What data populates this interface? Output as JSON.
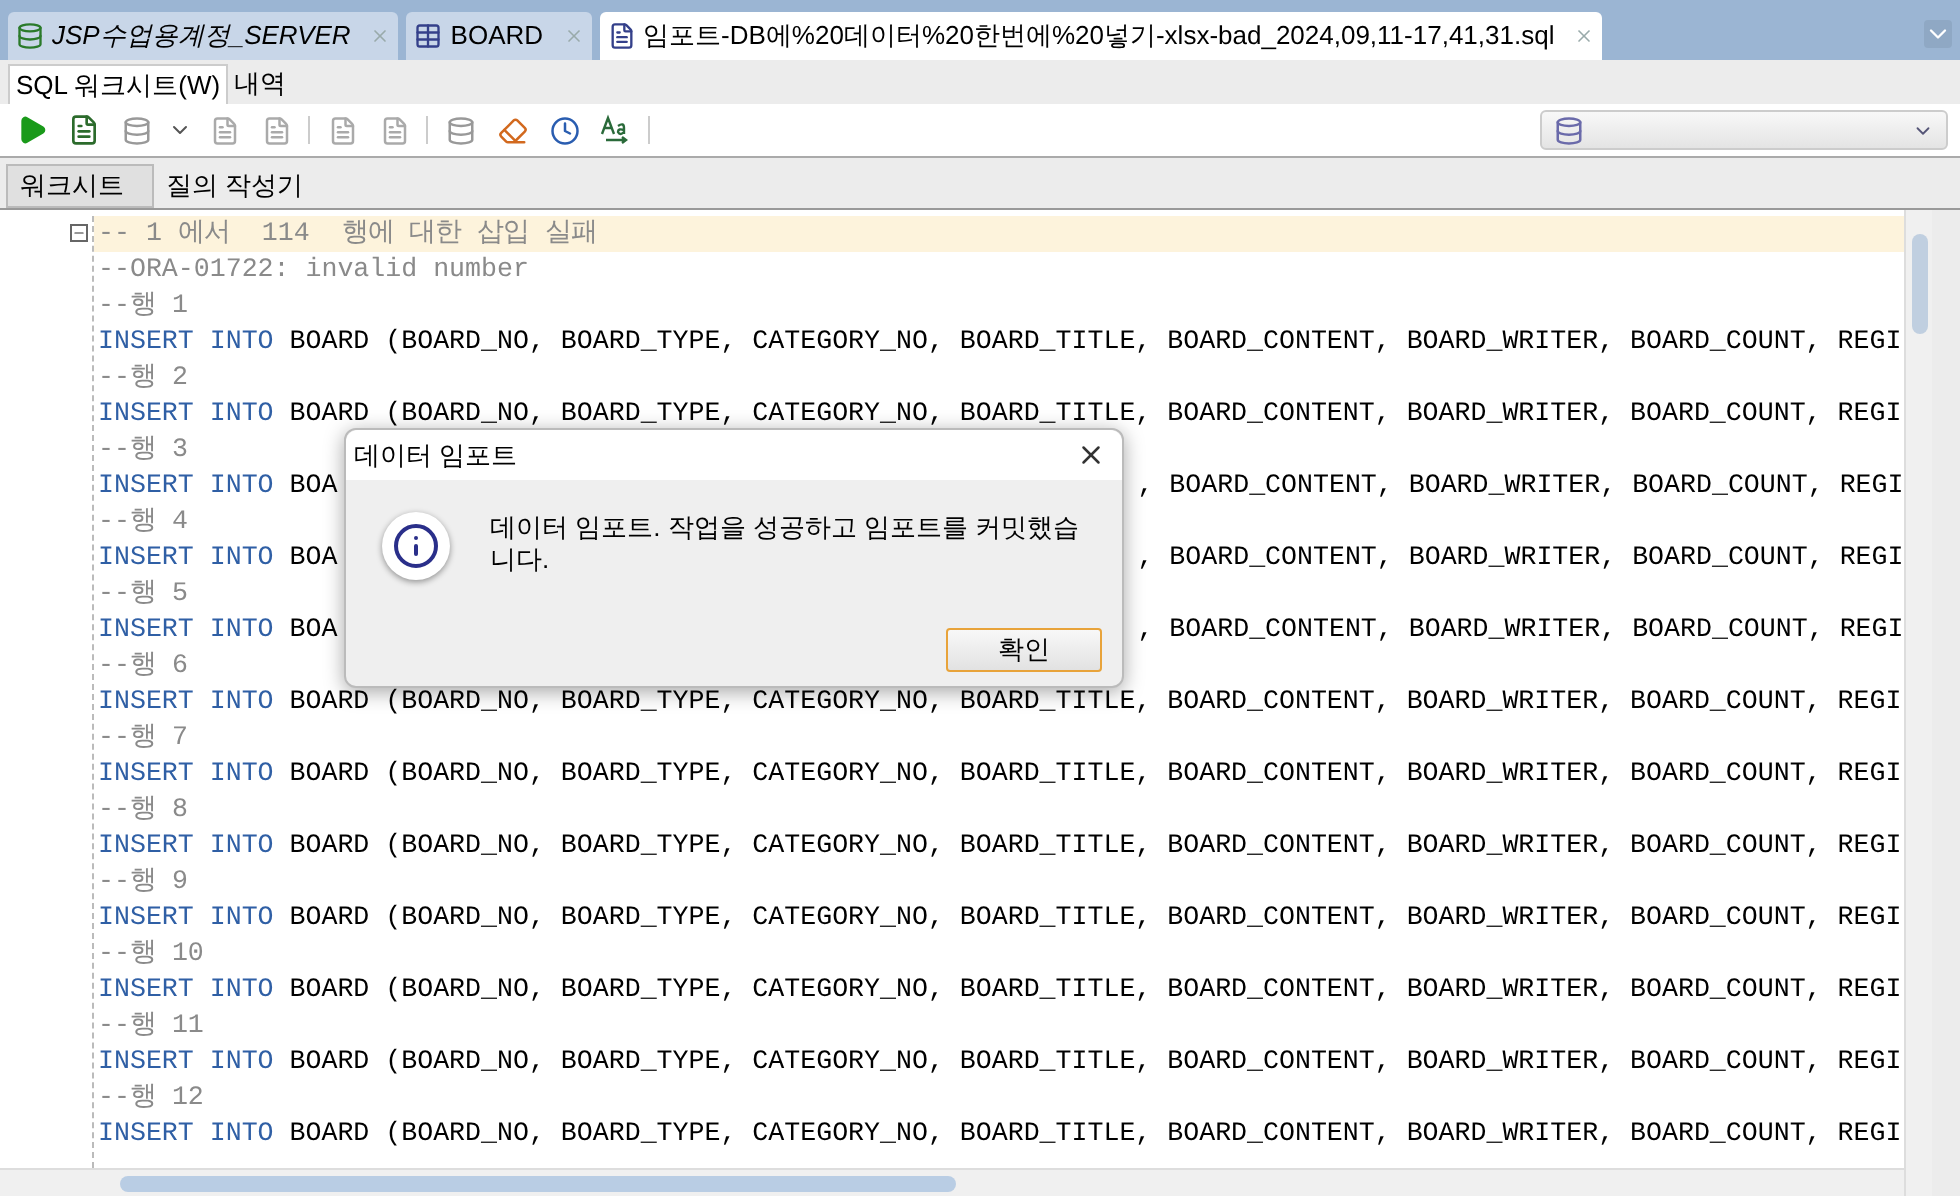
{
  "tabs": [
    {
      "label": "JSP수업용계정_SERVER",
      "kind": "connection",
      "selected": false
    },
    {
      "label": "BOARD",
      "kind": "table",
      "selected": false
    },
    {
      "label": "임포트-DB에%20데이터%20한번에%20넣기-xlsx-bad_2024,09,11-17,41,31.sql",
      "kind": "file",
      "selected": true
    }
  ],
  "menu_tabs": [
    {
      "label": "SQL 워크시트(W)",
      "selected": true
    },
    {
      "label": "내역",
      "selected": false
    }
  ],
  "sub_tabs": [
    {
      "label": "워크시트",
      "selected": true
    },
    {
      "label": "질의 작성기",
      "selected": false
    }
  ],
  "editor": {
    "lines": [
      {
        "kind": "header",
        "text": "-- 1 에서  114  행에 대한 삽입 실패",
        "current": true
      },
      {
        "kind": "comment",
        "text": "--ORA-01722: invalid number",
        "current": false
      },
      {
        "kind": "comment",
        "text": "--행 1",
        "current": false
      },
      {
        "kind": "insert",
        "keyword": "INSERT INTO",
        "text": "BOARD (BOARD_NO, BOARD_TYPE, CATEGORY_NO, BOARD_TITLE, BOARD_CONTENT, BOARD_WRITER, BOARD_COUNT, REGI",
        "current": false
      },
      {
        "kind": "comment",
        "text": "--행 2",
        "current": false
      },
      {
        "kind": "insert",
        "keyword": "INSERT INTO",
        "text": "BOARD (BOARD_NO, BOARD_TYPE, CATEGORY_NO, BOARD_TITLE, BOARD_CONTENT, BOARD_WRITER, BOARD_COUNT, REGI",
        "current": false
      },
      {
        "kind": "comment",
        "text": "--행 3",
        "current": false
      },
      {
        "kind": "insert",
        "keyword": "INSERT INTO",
        "text": "BOA",
        "text_after": ", BOARD_CONTENT, BOARD_WRITER, BOARD_COUNT, REGI",
        "current": false
      },
      {
        "kind": "comment",
        "text": "--행 4",
        "current": false
      },
      {
        "kind": "insert",
        "keyword": "INSERT INTO",
        "text": "BOA",
        "text_after": ", BOARD_CONTENT, BOARD_WRITER, BOARD_COUNT, REGI",
        "current": false
      },
      {
        "kind": "comment",
        "text": "--행 5",
        "current": false
      },
      {
        "kind": "insert",
        "keyword": "INSERT INTO",
        "text": "BOA",
        "text_after": ", BOARD_CONTENT, BOARD_WRITER, BOARD_COUNT, REGI",
        "current": false
      },
      {
        "kind": "comment",
        "text": "--행 6",
        "current": false
      },
      {
        "kind": "insert",
        "keyword": "INSERT INTO",
        "text": "BOARD (BOARD_NO, BOARD_TYPE, CATEGORY_NO, BOARD_TITLE, BOARD_CONTENT, BOARD_WRITER, BOARD_COUNT, REGI",
        "current": false
      },
      {
        "kind": "comment",
        "text": "--행 7",
        "current": false
      },
      {
        "kind": "insert",
        "keyword": "INSERT INTO",
        "text": "BOARD (BOARD_NO, BOARD_TYPE, CATEGORY_NO, BOARD_TITLE, BOARD_CONTENT, BOARD_WRITER, BOARD_COUNT, REGI",
        "current": false
      },
      {
        "kind": "comment",
        "text": "--행 8",
        "current": false
      },
      {
        "kind": "insert",
        "keyword": "INSERT INTO",
        "text": "BOARD (BOARD_NO, BOARD_TYPE, CATEGORY_NO, BOARD_TITLE, BOARD_CONTENT, BOARD_WRITER, BOARD_COUNT, REGI",
        "current": false
      },
      {
        "kind": "comment",
        "text": "--행 9",
        "current": false
      },
      {
        "kind": "insert",
        "keyword": "INSERT INTO",
        "text": "BOARD (BOARD_NO, BOARD_TYPE, CATEGORY_NO, BOARD_TITLE, BOARD_CONTENT, BOARD_WRITER, BOARD_COUNT, REGI",
        "current": false
      },
      {
        "kind": "comment",
        "text": "--행 10",
        "current": false
      },
      {
        "kind": "insert",
        "keyword": "INSERT INTO",
        "text": "BOARD (BOARD_NO, BOARD_TYPE, CATEGORY_NO, BOARD_TITLE, BOARD_CONTENT, BOARD_WRITER, BOARD_COUNT, REGI",
        "current": false
      },
      {
        "kind": "comment",
        "text": "--행 11",
        "current": false
      },
      {
        "kind": "insert",
        "keyword": "INSERT INTO",
        "text": "BOARD (BOARD_NO, BOARD_TYPE, CATEGORY_NO, BOARD_TITLE, BOARD_CONTENT, BOARD_WRITER, BOARD_COUNT, REGI",
        "current": false
      },
      {
        "kind": "comment",
        "text": "--행 12",
        "current": false
      },
      {
        "kind": "insert",
        "keyword": "INSERT INTO",
        "text": "BOARD (BOARD_NO, BOARD_TYPE, CATEGORY_NO, BOARD_TITLE, BOARD_CONTENT, BOARD_WRITER, BOARD_COUNT, REGI",
        "current": false
      }
    ]
  },
  "dialog": {
    "title": "데이터 임포트",
    "message": "데이터 임포트. 작업을 성공하고 임포트를 커밋했습니다.",
    "button": "확인"
  }
}
